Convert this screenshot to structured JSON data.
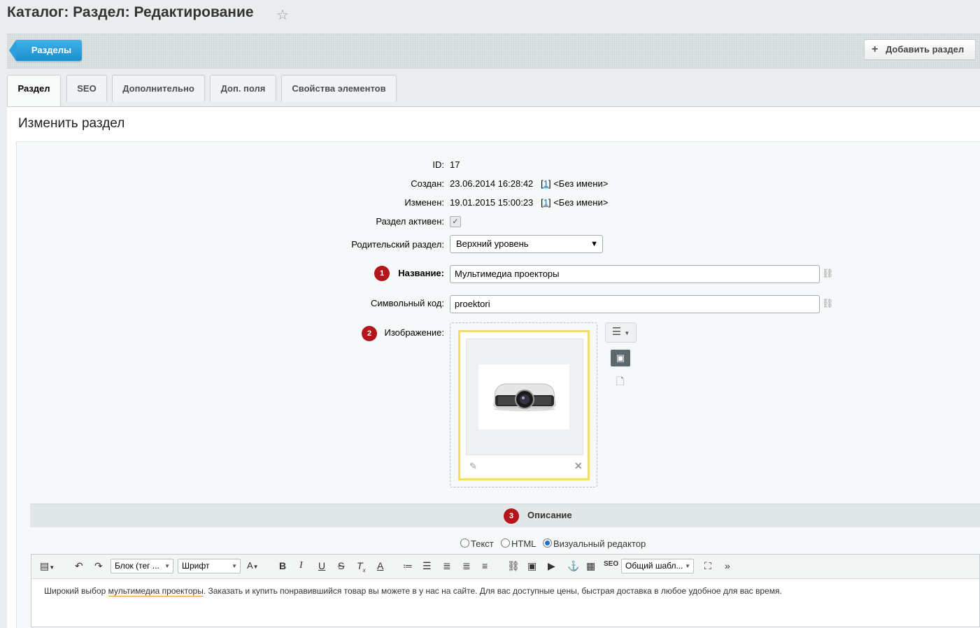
{
  "header": {
    "title": "Каталог: Раздел: Редактирование",
    "star_icon": "star-icon"
  },
  "topbar": {
    "back_button": "Разделы",
    "add_button": "Добавить раздел"
  },
  "tabs": [
    "Раздел",
    "SEO",
    "Дополнительно",
    "Доп. поля",
    "Свойства элементов"
  ],
  "panel": {
    "title": "Изменить раздел"
  },
  "form": {
    "id_label": "ID:",
    "id_value": "17",
    "created_label": "Создан:",
    "created_value": "23.06.2014 16:28:42",
    "created_user_link": "1",
    "created_user": "<Без имени>",
    "modified_label": "Изменен:",
    "modified_value": "19.01.2015 15:00:23",
    "modified_user_link": "1",
    "modified_user": "<Без имени>",
    "active_label": "Раздел активен:",
    "active_checked": true,
    "parent_label": "Родительский раздел:",
    "parent_value": "Верхний уровень",
    "name_label": "Название:",
    "name_value": "Мультимедиа проекторы",
    "code_label": "Символьный код:",
    "code_value": "proektori",
    "image_label": "Изображение:"
  },
  "badges": [
    "1",
    "2",
    "3"
  ],
  "description": {
    "title": "Описание",
    "modes": [
      "Текст",
      "HTML",
      "Визуальный редактор"
    ],
    "selected_mode": "Визуальный редактор",
    "toolbar": {
      "block_select": "Блок (тег ...",
      "font_select": "Шрифт",
      "template_select": "Общий шабл..."
    },
    "text_before": "Широкий выбор ",
    "text_link": "мультимедиа проекторы",
    "text_after": ". Заказать и купить понравившийся товар вы можете в у нас на сайте. Для вас доступные цены, быстрая доставка в любое удобное для вас время."
  },
  "colors": {
    "accent_blue": "#1b8ed2",
    "badge_red": "#b3151a",
    "image_frame": "#f3dd6a"
  }
}
